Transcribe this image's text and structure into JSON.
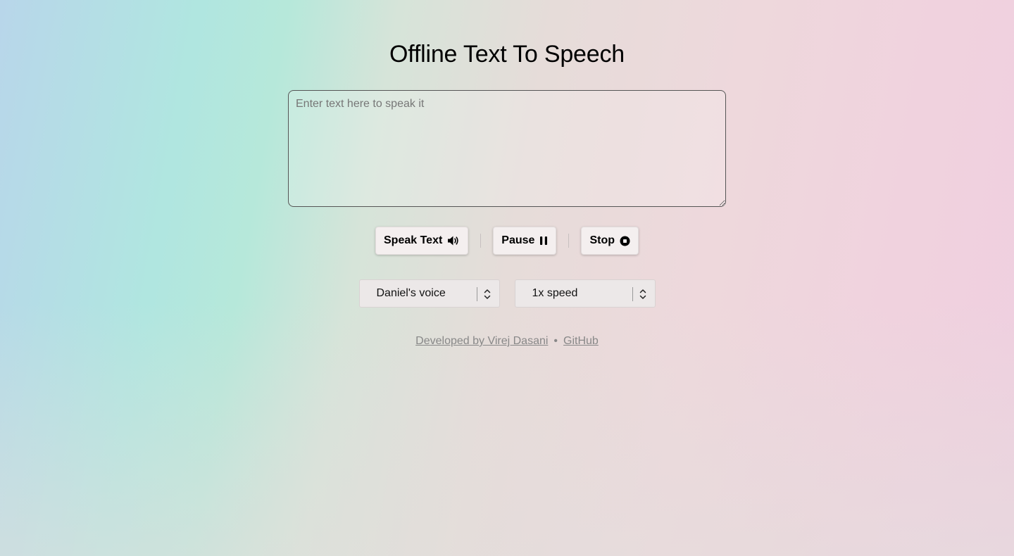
{
  "header": {
    "title": "Offline Text To Speech"
  },
  "input": {
    "placeholder": "Enter text here to speak it",
    "value": ""
  },
  "controls": {
    "speak_label": "Speak Text",
    "speak_icon": "speaker-icon",
    "pause_label": "Pause",
    "pause_icon": "pause-icon",
    "stop_label": "Stop",
    "stop_icon": "stop-icon"
  },
  "selects": {
    "voice": {
      "value": "Daniel's voice"
    },
    "speed": {
      "value": "1x speed"
    }
  },
  "footer": {
    "developer_link": "Developed by Virej Dasani",
    "separator": "•",
    "github_link": "GitHub"
  }
}
